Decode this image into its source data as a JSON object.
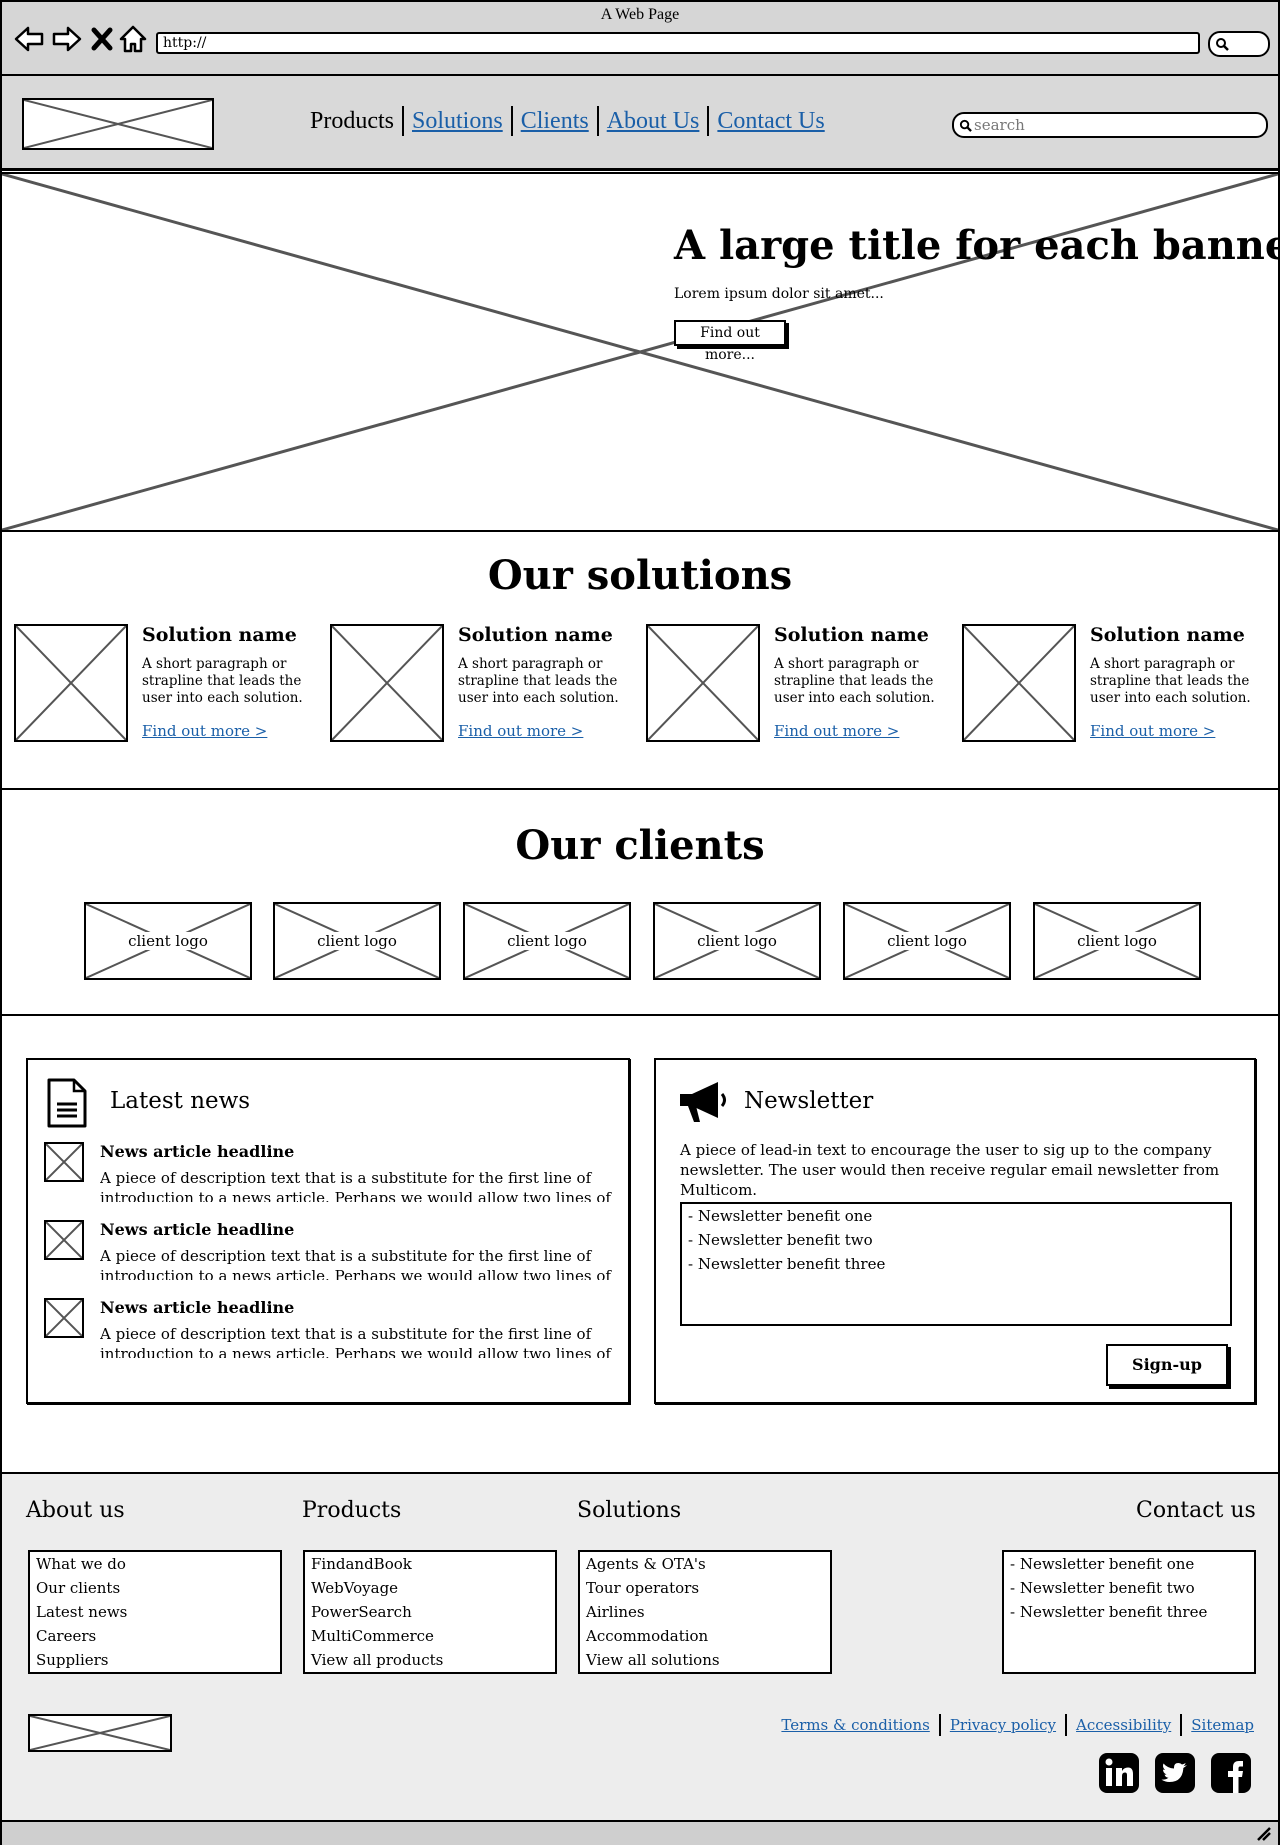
{
  "window": {
    "title": "A Web Page",
    "url": "http://"
  },
  "header": {
    "nav": [
      {
        "label": "Products",
        "active": true
      },
      {
        "label": "Solutions",
        "active": false
      },
      {
        "label": "Clients",
        "active": false
      },
      {
        "label": "About Us",
        "active": false
      },
      {
        "label": "Contact Us",
        "active": false
      }
    ],
    "search_placeholder": "search"
  },
  "banner": {
    "title": "A large title for each banner",
    "subtitle": "Lorem ipsum dolor sit amet...",
    "button": "Find out more..."
  },
  "solutions": {
    "title": "Our solutions",
    "items": [
      {
        "name": "Solution name",
        "desc": "A short paragraph or strapline that leads the user into each solution.",
        "link": "Find out more >"
      },
      {
        "name": "Solution name",
        "desc": "A short paragraph or strapline that leads the user into each solution.",
        "link": "Find out more >"
      },
      {
        "name": "Solution name",
        "desc": "A short paragraph or strapline that leads the user into each solution.",
        "link": "Find out more >"
      },
      {
        "name": "Solution name",
        "desc": "A short paragraph or strapline that leads the user into each solution.",
        "link": "Find out more >"
      }
    ]
  },
  "clients": {
    "title": "Our clients",
    "logos": [
      "client logo",
      "client logo",
      "client logo",
      "client logo",
      "client logo",
      "client logo"
    ]
  },
  "news": {
    "title": "Latest news",
    "items": [
      {
        "headline": "News article headline",
        "text": "A piece of description text that is a substitute for the first line of introduction to a news article. Perhaps we would allow two lines of text to begin with."
      },
      {
        "headline": "News article headline",
        "text": "A piece of description text that is a substitute for the first line of introduction to a news article. Perhaps we would allow two lines of text to begin with."
      },
      {
        "headline": "News article headline",
        "text": "A piece of description text that is a substitute for the first line of introduction to a news article. Perhaps we would allow two lines of text to begin with."
      }
    ]
  },
  "newsletter": {
    "title": "Newsletter",
    "lead": "A piece of lead-in text to encourage the user to sig up to the company newsletter. The user would then receive regular email newsletter from Multicom.",
    "benefits": [
      "- Newsletter benefit one",
      "- Newsletter benefit two",
      "- Newsletter benefit three"
    ],
    "button": "Sign-up"
  },
  "footer": {
    "columns": [
      {
        "title": "About us",
        "items": [
          "What we do",
          "Our clients",
          "Latest news",
          "Careers",
          "Suppliers"
        ]
      },
      {
        "title": "Products",
        "items": [
          "FindandBook",
          "WebVoyage",
          "PowerSearch",
          "MultiCommerce",
          "View all products"
        ]
      },
      {
        "title": "Solutions",
        "items": [
          "Agents & OTA's",
          "Tour operators",
          "Airlines",
          "Accommodation",
          "View all solutions"
        ]
      },
      {
        "title": "Contact us",
        "items": [
          "- Newsletter benefit one",
          "- Newsletter benefit two",
          "- Newsletter benefit three"
        ]
      }
    ],
    "links": [
      "Terms & conditions",
      "Privacy policy",
      "Accessibility",
      "Sitemap"
    ],
    "social": [
      "linkedin-icon",
      "twitter-icon",
      "facebook-icon"
    ]
  },
  "colors": {
    "link": "#1a5fa8",
    "header_bg": "#d9d9d9",
    "footer_bg": "#ededed",
    "chrome_bg": "#d6d6d6"
  }
}
